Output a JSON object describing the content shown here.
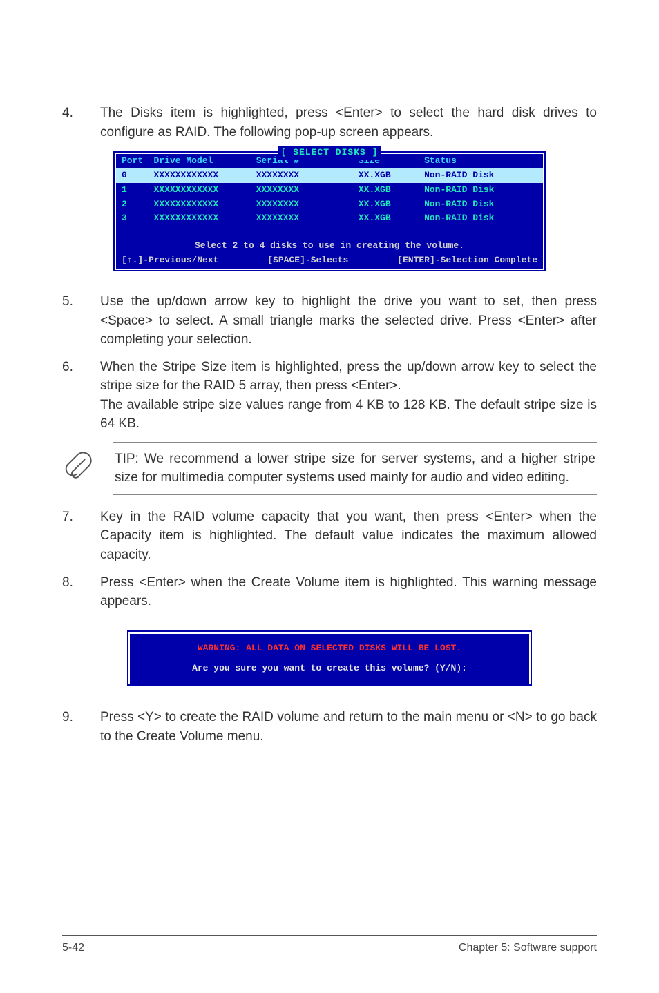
{
  "steps": {
    "s4": {
      "num": "4.",
      "text": "The Disks item is highlighted, press <Enter> to select the hard disk drives to configure as RAID. The following pop-up screen appears."
    },
    "s5": {
      "num": "5.",
      "text": "Use the up/down arrow key to highlight the drive you want to set, then press <Space> to select.  A small triangle marks the selected drive. Press <Enter> after completing your selection."
    },
    "s6": {
      "num": "6.",
      "text": "When the Stripe Size item is highlighted, press the up/down arrow key to select the stripe size for the RAID 5 array, then press <Enter>.\nThe available stripe size values range from 4 KB to 128 KB. The default stripe size is 64 KB."
    },
    "s7": {
      "num": "7.",
      "text": "Key in the RAID volume capacity that you want, then press <Enter> when the Capacity item is highlighted. The default value indicates the maximum allowed capacity."
    },
    "s8": {
      "num": "8.",
      "text": "Press <Enter> when the Create Volume item is highlighted. This warning message appears."
    },
    "s9": {
      "num": "9.",
      "text": "Press <Y> to create the RAID volume and return to the main menu or <N> to go back to the Create Volume menu."
    }
  },
  "select_disks": {
    "title": "[ SELECT DISKS ]",
    "headers": {
      "port": "Port",
      "model": "Drive Model",
      "serial": "Serial #",
      "size": "Size",
      "status": "Status"
    },
    "rows": [
      {
        "port": "0",
        "model": "XXXXXXXXXXXX",
        "serial": "XXXXXXXX",
        "size": "XX.XGB",
        "status": "Non-RAID Disk",
        "selected": true
      },
      {
        "port": "1",
        "model": "XXXXXXXXXXXX",
        "serial": "XXXXXXXX",
        "size": "XX.XGB",
        "status": "Non-RAID Disk",
        "selected": false
      },
      {
        "port": "2",
        "model": "XXXXXXXXXXXX",
        "serial": "XXXXXXXX",
        "size": "XX.XGB",
        "status": "Non-RAID Disk",
        "selected": false
      },
      {
        "port": "3",
        "model": "XXXXXXXXXXXX",
        "serial": "XXXXXXXX",
        "size": "XX.XGB",
        "status": "Non-RAID Disk",
        "selected": false
      }
    ],
    "hint": "Select 2 to 4 disks to use in creating the volume.",
    "footer": {
      "prev": "[↑↓]-Previous/Next",
      "sel": "[SPACE]-Selects",
      "done": "[ENTER]-Selection Complete"
    }
  },
  "tip": {
    "text": "TIP: We recommend a lower stripe size for server systems, and a higher stripe size for multimedia computer systems used mainly for audio and video editing."
  },
  "warning": {
    "line1": "WARNING: ALL DATA ON SELECTED DISKS WILL BE LOST.",
    "line2": "Are you sure you want to create this volume? (Y/N):"
  },
  "footer": {
    "left": "5-42",
    "right": "Chapter 5: Software support"
  }
}
